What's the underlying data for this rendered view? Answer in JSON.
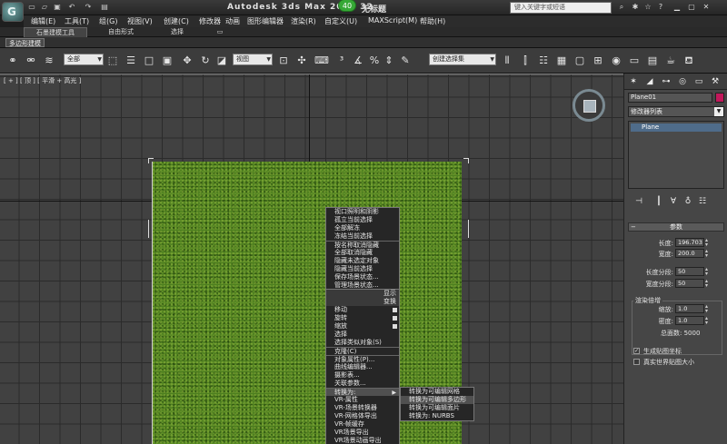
{
  "titlebar": {
    "app_name": "Autodesk 3ds Max   2010 32",
    "badge": "40",
    "file_name": "无标题",
    "search_placeholder": "键入关键字或短语"
  },
  "menu": [
    "编辑(E)",
    "工具(T)",
    "组(G)",
    "视图(V)",
    "创建(C)",
    "修改器",
    "动画",
    "图形编辑器",
    "渲染(R)",
    "自定义(U)",
    "MAXScript(M)",
    "帮助(H)"
  ],
  "ribbon": {
    "tabs": [
      "石墨建模工具",
      "自由形式",
      "选择"
    ],
    "subtab": "多边形建模"
  },
  "toolbar": {
    "filter_dropdown": "全部",
    "refcoord_dropdown": "视图",
    "selset_dropdown": "创建选择集"
  },
  "viewport": {
    "label": "[ + ] [ 顶 ] [ 平滑 + 高光 ]"
  },
  "quad_menu": {
    "left_top": [
      "视口照明和阴影",
      "孤立当前选择",
      "全部解冻",
      "冻结当前选择",
      "按名称取消隐藏",
      "全部取消隐藏",
      "隐藏未选定对象",
      "隐藏当前选择",
      "保存场景状态...",
      "管理场景状态..."
    ],
    "headers": [
      "显示",
      "变换"
    ],
    "left_bottom": [
      "移动",
      "旋转",
      "缩放",
      "选择",
      "选择类似对象(S)",
      "克隆(C)",
      "对象属性(P)...",
      "曲线编辑器...",
      "摄影表...",
      "关联参数...",
      "转换为:",
      "VR-属性",
      "VR-场景转换器",
      "VR-网格体导出",
      "VR-帧缓存",
      "VR场景导出",
      "VR场景动画导出"
    ],
    "submenu": [
      "转换为可编辑网格",
      "转换为可编辑多边形",
      "转换为可编辑面片",
      "转换为: NURBS"
    ]
  },
  "panel": {
    "object_name": "Plane01",
    "object_color": "#c2185b",
    "modifier_list": "修改器列表",
    "stack_item": "Plane",
    "rollout_title": "参数",
    "params": [
      {
        "label": "长度:",
        "value": "196.703"
      },
      {
        "label": "宽度:",
        "value": "200.0"
      },
      {
        "label": "长度分段:",
        "value": "50"
      },
      {
        "label": "宽度分段:",
        "value": "50"
      }
    ],
    "render_group_title": "渲染倍增",
    "render_params": [
      {
        "label": "缩放:",
        "value": "1.0"
      },
      {
        "label": "密度:",
        "value": "1.0"
      }
    ],
    "total_faces": "总面数: 5000",
    "checkboxes": [
      {
        "label": "生成贴图坐标",
        "checked": true
      },
      {
        "label": "真实世界贴图大小",
        "checked": false
      }
    ]
  }
}
